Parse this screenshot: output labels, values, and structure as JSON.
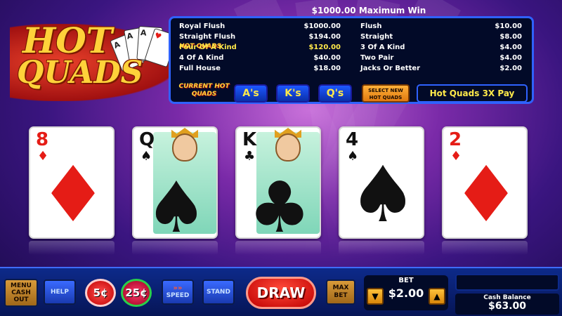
{
  "header": {
    "max_win": "$1000.00 Maximum Win"
  },
  "logo": {
    "line1": "HOT",
    "line2": "QUADS"
  },
  "paytable": {
    "left": [
      {
        "hand": "Royal Flush",
        "pay": "$1000.00"
      },
      {
        "hand": "Straight Flush",
        "pay": "$194.00"
      },
      {
        "hand": "Four Of A Kind",
        "pay": "$120.00",
        "prefix": "HOT QUADS"
      },
      {
        "hand": "4 Of A Kind",
        "pay": "$40.00"
      },
      {
        "hand": "Full House",
        "pay": "$18.00"
      }
    ],
    "right": [
      {
        "hand": "Flush",
        "pay": "$10.00"
      },
      {
        "hand": "Straight",
        "pay": "$8.00"
      },
      {
        "hand": "3 Of A Kind",
        "pay": "$4.00"
      },
      {
        "hand": "Two Pair",
        "pay": "$4.00"
      },
      {
        "hand": "Jacks Or Better",
        "pay": "$2.00"
      }
    ],
    "current_hot_quads_label": "CURRENT HOT QUADS",
    "hot_quads_ranks": [
      "A's",
      "K's",
      "Q's"
    ],
    "select_new_label": "SELECT NEW HOT QUADS",
    "pay_multiplier_label": "Hot Quads 3X Pay"
  },
  "cards": [
    {
      "rank": "8",
      "suit": "♦",
      "color": "red",
      "face": false
    },
    {
      "rank": "Q",
      "suit": "♠",
      "color": "black",
      "face": true
    },
    {
      "rank": "K",
      "suit": "♣",
      "color": "black",
      "face": true
    },
    {
      "rank": "4",
      "suit": "♠",
      "color": "black",
      "face": false
    },
    {
      "rank": "2",
      "suit": "♦",
      "color": "red",
      "face": false
    }
  ],
  "controls": {
    "menu_label_1": "MENU",
    "menu_label_2": "CASH",
    "menu_label_3": "OUT",
    "help_label": "HELP",
    "coin_5": "5¢",
    "coin_25": "25¢",
    "speed_label": "SPEED",
    "stand_label": "STAND",
    "draw_label": "DRAW",
    "max_label": "MAX",
    "bet_label_2": "BET",
    "bet_title": "BET",
    "bet_value": "$2.00",
    "cash_balance_label": "Cash Balance",
    "cash_balance_value": "$63.00"
  },
  "colors": {
    "accent_blue": "#2f62ff",
    "gold": "#ffd23a",
    "red": "#e51c16"
  }
}
